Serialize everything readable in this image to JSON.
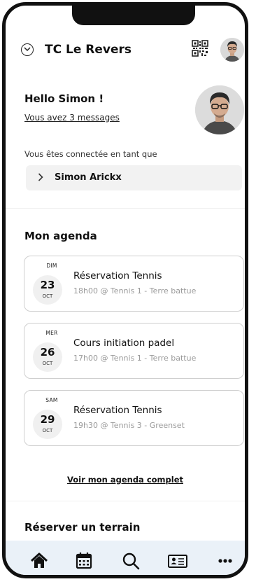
{
  "header": {
    "club_name": "TC Le Revers",
    "icons": [
      "chevron-circle-icon",
      "qr-code-icon",
      "avatar"
    ]
  },
  "welcome": {
    "greeting": "Hello Simon !",
    "messages_link": "Vous avez 3 messages",
    "connected_label": "Vous êtes connectée en tant que",
    "user_name": "Simon Arickx"
  },
  "agenda": {
    "title": "Mon agenda",
    "events": [
      {
        "dow": "DIM",
        "day": "23",
        "month": "OCT",
        "title": "Réservation Tennis",
        "detail": "18h00 @ Tennis 1 - Terre battue"
      },
      {
        "dow": "MER",
        "day": "26",
        "month": "OCT",
        "title": "Cours initiation padel",
        "detail": "17h00 @ Tennis 1 - Terre battue"
      },
      {
        "dow": "SAM",
        "day": "29",
        "month": "OCT",
        "title": "Réservation Tennis",
        "detail": "19h30 @ Tennis 3 - Greenset"
      }
    ],
    "full_link": "Voir mon agenda complet"
  },
  "reserve": {
    "title": "Réserver un terrain"
  },
  "tabbar": {
    "items": [
      "home-icon",
      "calendar-icon",
      "search-icon",
      "member-card-icon",
      "more-icon"
    ]
  }
}
